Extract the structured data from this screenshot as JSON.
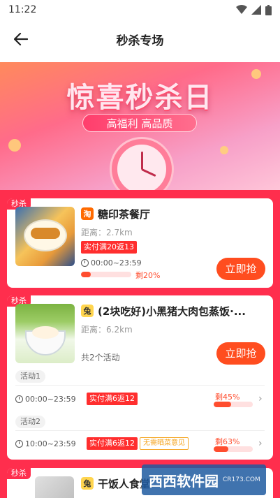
{
  "status_bar": {
    "time": "11:22",
    "icons": [
      "wifi-icon",
      "signal-icon",
      "battery-icon"
    ]
  },
  "nav": {
    "title": "秒杀专场",
    "back_icon": "arrow-left-icon"
  },
  "banner": {
    "title": "惊喜秒杀日",
    "subtitle": "高福利 高品质"
  },
  "colors": {
    "accent": "#ff2e4d",
    "button": "#ff4d1f",
    "promo": "#ff2e2e"
  },
  "cards": [
    {
      "tag": "秒杀",
      "shop_name": "糖印茶餐厅",
      "shop_icon_text": "淘",
      "distance": "距离：2.7km",
      "promo": "实付满20返13",
      "time": "00:00~23:59",
      "remain": "剩20%",
      "progress": 0.2,
      "button": "立即抢"
    },
    {
      "tag": "秒杀",
      "shop_name": "(2块吃好)小黑猪大肉包蒸饭·...",
      "distance": "距离：6.2km",
      "activity_count": "共2个活动",
      "button": "立即抢",
      "activities": [
        {
          "label": "活动1",
          "time": "00:00~23:59",
          "promo": "实付满6返12",
          "remain": "剩45%",
          "progress": 0.45
        },
        {
          "label": "活动2",
          "time": "10:00~23:59",
          "promo": "实付满6返12",
          "extra": "无需晒菜意见",
          "remain": "剩63%",
          "progress": 0.37
        }
      ]
    },
    {
      "tag": "秒杀",
      "shop_name": "干饭人食堂"
    }
  ],
  "watermark": {
    "big": "西西软件园",
    "small": "CR173.COM"
  }
}
